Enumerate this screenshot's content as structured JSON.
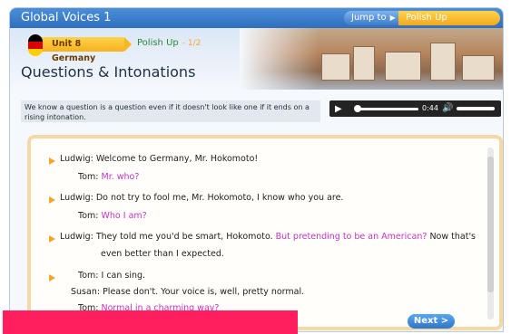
{
  "header": {
    "brand_text": "Global Voices 1",
    "jump_to_label": "Jump to",
    "jump_to_value": "Polish Up"
  },
  "unit": {
    "label": "Unit 8 Germany",
    "section": "Polish Up",
    "page": "- 1/2"
  },
  "lesson": {
    "title": "Questions & Intonations",
    "description": "We know a question is a question even if it doesn't look like one if it ends on a rising intonation."
  },
  "audio": {
    "time": "0:44",
    "progress_fraction": 0.02,
    "volume_fraction": 1.0
  },
  "dialog": [
    {
      "speaker": "Ludwig:",
      "text": "Welcome to Germany, Mr. Hokomoto!",
      "highlight": false
    },
    {
      "speaker": "Tom:",
      "text": "Mr. who?",
      "highlight": true
    },
    {
      "speaker": "Ludwig:",
      "text": "Do not try to fool me, Mr. Hokomoto, I know who you are.",
      "highlight": false
    },
    {
      "speaker": "Tom:",
      "text": "Who I am?",
      "highlight": true
    },
    {
      "speaker": "Ludwig:",
      "text_plain": "They told me you'd be smart, Hokomoto.",
      "text_pink": "But pretending to be an American?",
      "text_tail": "Now that's",
      "cont": "even better than I expected."
    },
    {
      "speaker": "Tom:",
      "text": "I can sing.",
      "highlight": false
    },
    {
      "speaker": "Susan:",
      "text": "Please don't. Your voice is, well, pretty normal.",
      "highlight": false
    },
    {
      "speaker": "Tom:",
      "text": "Normal in a charming way?",
      "highlight": true
    }
  ],
  "nav": {
    "next_label": "Next >"
  },
  "colors": {
    "accent_blue": "#2f6fbe",
    "accent_orange": "#f6b11d",
    "highlight_pink": "#c236c2",
    "overlay_red": "#ff1f5e"
  },
  "icons": [
    "play-icon",
    "volume-icon",
    "arrow-bullet-icon",
    "germany-flag-icon"
  ]
}
